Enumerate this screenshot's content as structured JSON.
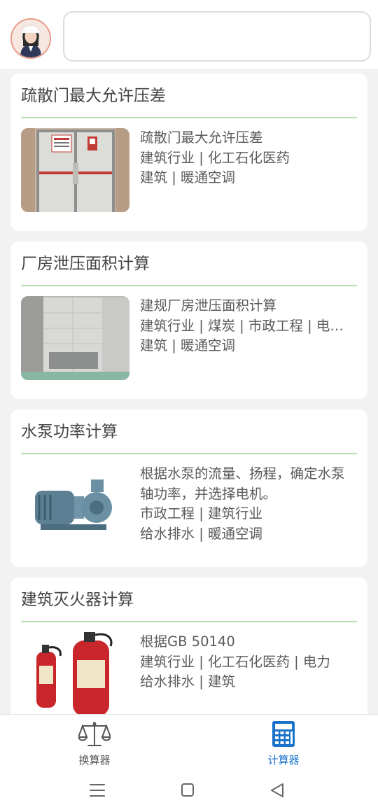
{
  "header": {
    "avatar": "avatar-woman-hardhat",
    "search": {
      "value": "",
      "placeholder": ""
    }
  },
  "cards": [
    {
      "title": "疏散门最大允许压差",
      "image": "evacuation-door-photo",
      "description": "疏散门最大允许压差",
      "industries": "建筑行业 | 化工石化医药",
      "disciplines": "建筑 | 暖通空调"
    },
    {
      "title": "厂房泄压面积计算",
      "image": "factory-wall-photo",
      "description": "建规厂房泄压面积计算",
      "industries": "建筑行业 | 煤炭 | 市政工程 | 电…",
      "disciplines": "建筑 | 暖通空调"
    },
    {
      "title": "水泵功率计算",
      "image": "water-pump-photo",
      "description": "根据水泵的流量、扬程，确定水泵轴功率，并选择电机。",
      "industries": "市政工程 | 建筑行业",
      "disciplines": "给水排水 | 暖通空调"
    },
    {
      "title": "建筑灭火器计算",
      "image": "fire-extinguisher-photo",
      "description": "根据GB 50140",
      "industries": "建筑行业 | 化工石化医药 | 电力",
      "disciplines": "给水排水 | 建筑"
    }
  ],
  "bottom_nav": {
    "items": [
      {
        "label": "换算器",
        "icon": "balance-scale-icon",
        "active": false
      },
      {
        "label": "计算器",
        "icon": "calculator-icon",
        "active": true
      }
    ],
    "active_color": "#1a73c9",
    "inactive_color": "#555555"
  },
  "system_nav": {
    "menu": "menu-icon",
    "home": "home-icon",
    "back": "back-icon"
  },
  "colors": {
    "accent": "#1a73c9",
    "divider": "#b6e0b0",
    "background": "#f2f2f2"
  }
}
